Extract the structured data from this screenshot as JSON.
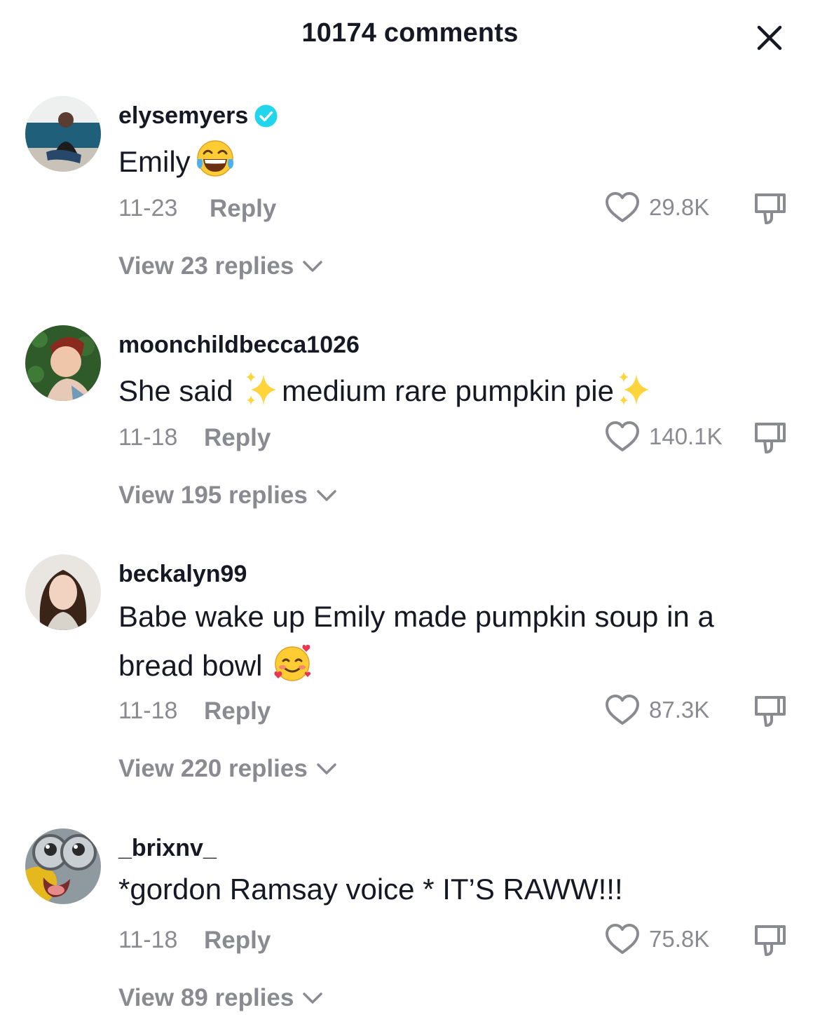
{
  "header": {
    "title": "10174 comments",
    "close_icon": "close-icon"
  },
  "colors": {
    "text": "#161823",
    "muted": "#8a8b91",
    "verified": "#20d5ec"
  },
  "comments": [
    {
      "username": "elysemyers",
      "verified": true,
      "text": "Emily",
      "date": "11-23",
      "reply_label": "Reply",
      "likes": "29.8K",
      "view_replies": "View 23 replies",
      "emoji": "face-with-tears-of-joy"
    },
    {
      "username": "moonchildbecca1026",
      "verified": false,
      "text_parts": [
        "She said",
        "medium rare pumpkin pie"
      ],
      "date": "11-18",
      "reply_label": "Reply",
      "likes": "140.1K",
      "view_replies": "View 195 replies",
      "emoji": "sparkles"
    },
    {
      "username": "beckalyn99",
      "verified": false,
      "text_lines": [
        "Babe wake up Emily made pumpkin soup in a",
        "bread bowl"
      ],
      "date": "11-18",
      "reply_label": "Reply",
      "likes": "87.3K",
      "view_replies": "View 220 replies",
      "emoji": "smiling-face-with-hearts"
    },
    {
      "username": "_brixnv_",
      "verified": false,
      "text": "*gordon Ramsay voice * IT’S RAWW!!!",
      "date": "11-18",
      "reply_label": "Reply",
      "likes": "75.8K",
      "view_replies": "View 89 replies"
    }
  ]
}
